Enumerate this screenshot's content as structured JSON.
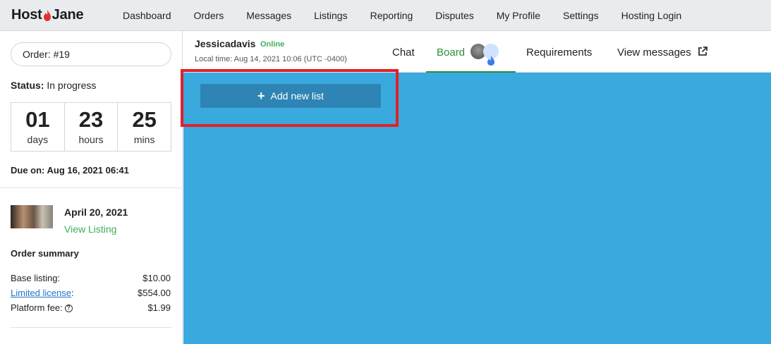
{
  "brand": {
    "name_left": "Host",
    "name_right": "Jane"
  },
  "nav": [
    "Dashboard",
    "Orders",
    "Messages",
    "Listings",
    "Reporting",
    "Disputes",
    "My Profile",
    "Settings",
    "Hosting Login"
  ],
  "sidebar": {
    "order": "Order: #19",
    "status_label": "Status:",
    "status_value": "In progress",
    "countdown": [
      {
        "num": "01",
        "unit": "days"
      },
      {
        "num": "23",
        "unit": "hours"
      },
      {
        "num": "25",
        "unit": "mins"
      }
    ],
    "due": "Due on: Aug 16, 2021 06:41",
    "listing_date": "April 20, 2021",
    "view_listing": "View Listing",
    "summary_title": "Order summary",
    "summary": [
      {
        "label": "Base listing:",
        "value": "$10.00"
      },
      {
        "label": "Limited license",
        "suffix": ":",
        "value": "$554.00"
      },
      {
        "label": "Platform fee:",
        "value": "$1.99"
      }
    ]
  },
  "header": {
    "username": "Jessicadavis",
    "online": "Online",
    "local_time": "Local time:  Aug 14, 2021 10:06 (UTC -0400)",
    "tabs": {
      "chat": "Chat",
      "board": "Board",
      "requirements": "Requirements",
      "view_messages": "View messages"
    }
  },
  "board": {
    "add_list": "Add new list"
  },
  "colors": {
    "board_bg": "#3aa9dd",
    "button_bg": "#2e84b4",
    "accent_green": "#2e8b3d",
    "highlight": "#e2202a"
  }
}
